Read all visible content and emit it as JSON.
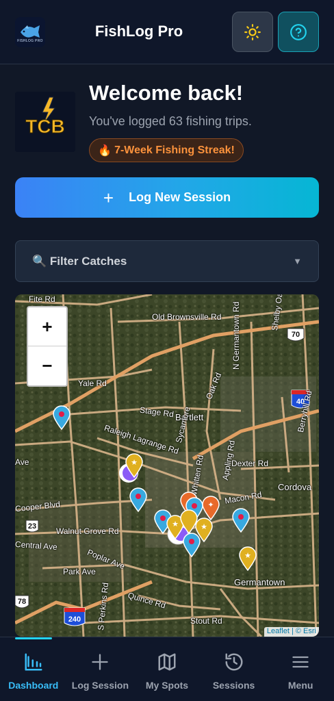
{
  "header": {
    "app_title": "FishLog Pro",
    "logo_text": "FISHLOG PRO",
    "theme_icon": "sun-icon",
    "help_icon": "help-circle-icon"
  },
  "welcome": {
    "avatar_text": "TCB",
    "title": "Welcome back!",
    "subtitle": "You've logged 63 fishing trips.",
    "streak_icon": "🔥",
    "streak_text": "7-Week Fishing Streak!"
  },
  "actions": {
    "log_new_session_icon": "+",
    "log_new_session_label": "Log New Session"
  },
  "filter": {
    "icon": "🔍",
    "label": "Filter Catches",
    "caret": "▼"
  },
  "map": {
    "zoom_in": "+",
    "zoom_out": "−",
    "attribution": "Leaflet | © Esri",
    "labels": {
      "fite_rd": "Fite Rd",
      "old_brownsville": "Old Brownsville Rd",
      "yale_rd": "Yale Rd",
      "stage_rd": "Stage Rd",
      "bartlett": "Bartlett",
      "raleigh_lagrange": "Raleigh Lagrange Rd",
      "dexter_rd": "Dexter Rd",
      "cordova": "Cordova",
      "macon_rd": "Macon Rd",
      "coopers_blvd": "Cooper Blvd",
      "walnut_grove": "Walnut Grove Rd",
      "central_ave": "Central Ave",
      "poplar_ave": "Poplar Ave",
      "park_ave": "Park Ave",
      "germantown": "Germantown",
      "quince_rd": "Quince Rd",
      "stout_rd": "Stout Rd",
      "n_germantown": "N Germantown Rd",
      "appling_rd": "Appling Rd",
      "whitten_rd": "Whitten Rd",
      "oak_rd": "Oak Rd",
      "sycamore": "Sycamore",
      "berryhill": "Berryhill Rd",
      "shelby_oaks": "Shelby Oaks",
      "perkins": "S Perkins Rd",
      "ave": "Ave",
      "i40": "40",
      "us70": "70",
      "i240": "240",
      "us78": "78",
      "r23": "23"
    }
  },
  "nav": {
    "items": [
      {
        "label": "Dashboard",
        "icon": "bar-chart-icon"
      },
      {
        "label": "Log Session",
        "icon": "plus-icon"
      },
      {
        "label": "My Spots",
        "icon": "map-icon"
      },
      {
        "label": "Sessions",
        "icon": "history-icon"
      },
      {
        "label": "Menu",
        "icon": "menu-icon"
      }
    ]
  },
  "colors": {
    "accent": "#38bdf8",
    "streak": "#fb923c",
    "pin_blue": "#38a9e0",
    "pin_yellow": "#e0b020",
    "pin_orange": "#e86a2a",
    "pin_purple": "#8b5cf6"
  }
}
